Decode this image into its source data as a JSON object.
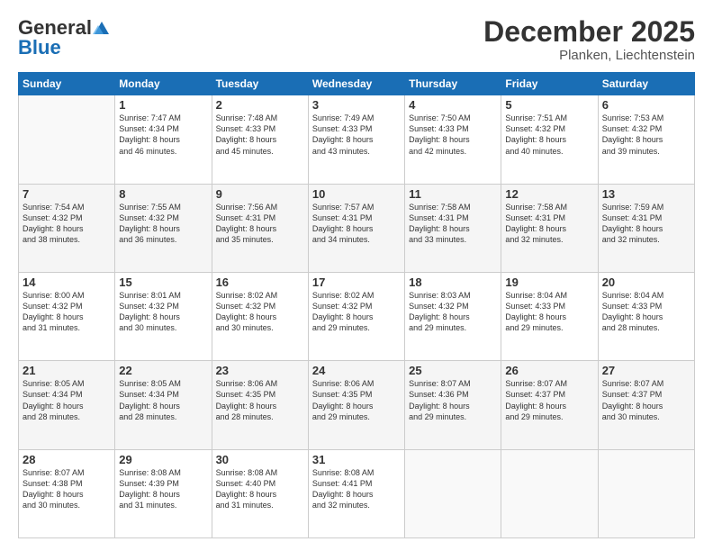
{
  "header": {
    "logo_general": "General",
    "logo_blue": "Blue",
    "month": "December 2025",
    "location": "Planken, Liechtenstein"
  },
  "days_of_week": [
    "Sunday",
    "Monday",
    "Tuesday",
    "Wednesday",
    "Thursday",
    "Friday",
    "Saturday"
  ],
  "weeks": [
    [
      {
        "day": "",
        "info": ""
      },
      {
        "day": "1",
        "info": "Sunrise: 7:47 AM\nSunset: 4:34 PM\nDaylight: 8 hours\nand 46 minutes."
      },
      {
        "day": "2",
        "info": "Sunrise: 7:48 AM\nSunset: 4:33 PM\nDaylight: 8 hours\nand 45 minutes."
      },
      {
        "day": "3",
        "info": "Sunrise: 7:49 AM\nSunset: 4:33 PM\nDaylight: 8 hours\nand 43 minutes."
      },
      {
        "day": "4",
        "info": "Sunrise: 7:50 AM\nSunset: 4:33 PM\nDaylight: 8 hours\nand 42 minutes."
      },
      {
        "day": "5",
        "info": "Sunrise: 7:51 AM\nSunset: 4:32 PM\nDaylight: 8 hours\nand 40 minutes."
      },
      {
        "day": "6",
        "info": "Sunrise: 7:53 AM\nSunset: 4:32 PM\nDaylight: 8 hours\nand 39 minutes."
      }
    ],
    [
      {
        "day": "7",
        "info": "Sunrise: 7:54 AM\nSunset: 4:32 PM\nDaylight: 8 hours\nand 38 minutes."
      },
      {
        "day": "8",
        "info": "Sunrise: 7:55 AM\nSunset: 4:32 PM\nDaylight: 8 hours\nand 36 minutes."
      },
      {
        "day": "9",
        "info": "Sunrise: 7:56 AM\nSunset: 4:31 PM\nDaylight: 8 hours\nand 35 minutes."
      },
      {
        "day": "10",
        "info": "Sunrise: 7:57 AM\nSunset: 4:31 PM\nDaylight: 8 hours\nand 34 minutes."
      },
      {
        "day": "11",
        "info": "Sunrise: 7:58 AM\nSunset: 4:31 PM\nDaylight: 8 hours\nand 33 minutes."
      },
      {
        "day": "12",
        "info": "Sunrise: 7:58 AM\nSunset: 4:31 PM\nDaylight: 8 hours\nand 32 minutes."
      },
      {
        "day": "13",
        "info": "Sunrise: 7:59 AM\nSunset: 4:31 PM\nDaylight: 8 hours\nand 32 minutes."
      }
    ],
    [
      {
        "day": "14",
        "info": "Sunrise: 8:00 AM\nSunset: 4:32 PM\nDaylight: 8 hours\nand 31 minutes."
      },
      {
        "day": "15",
        "info": "Sunrise: 8:01 AM\nSunset: 4:32 PM\nDaylight: 8 hours\nand 30 minutes."
      },
      {
        "day": "16",
        "info": "Sunrise: 8:02 AM\nSunset: 4:32 PM\nDaylight: 8 hours\nand 30 minutes."
      },
      {
        "day": "17",
        "info": "Sunrise: 8:02 AM\nSunset: 4:32 PM\nDaylight: 8 hours\nand 29 minutes."
      },
      {
        "day": "18",
        "info": "Sunrise: 8:03 AM\nSunset: 4:32 PM\nDaylight: 8 hours\nand 29 minutes."
      },
      {
        "day": "19",
        "info": "Sunrise: 8:04 AM\nSunset: 4:33 PM\nDaylight: 8 hours\nand 29 minutes."
      },
      {
        "day": "20",
        "info": "Sunrise: 8:04 AM\nSunset: 4:33 PM\nDaylight: 8 hours\nand 28 minutes."
      }
    ],
    [
      {
        "day": "21",
        "info": "Sunrise: 8:05 AM\nSunset: 4:34 PM\nDaylight: 8 hours\nand 28 minutes."
      },
      {
        "day": "22",
        "info": "Sunrise: 8:05 AM\nSunset: 4:34 PM\nDaylight: 8 hours\nand 28 minutes."
      },
      {
        "day": "23",
        "info": "Sunrise: 8:06 AM\nSunset: 4:35 PM\nDaylight: 8 hours\nand 28 minutes."
      },
      {
        "day": "24",
        "info": "Sunrise: 8:06 AM\nSunset: 4:35 PM\nDaylight: 8 hours\nand 29 minutes."
      },
      {
        "day": "25",
        "info": "Sunrise: 8:07 AM\nSunset: 4:36 PM\nDaylight: 8 hours\nand 29 minutes."
      },
      {
        "day": "26",
        "info": "Sunrise: 8:07 AM\nSunset: 4:37 PM\nDaylight: 8 hours\nand 29 minutes."
      },
      {
        "day": "27",
        "info": "Sunrise: 8:07 AM\nSunset: 4:37 PM\nDaylight: 8 hours\nand 30 minutes."
      }
    ],
    [
      {
        "day": "28",
        "info": "Sunrise: 8:07 AM\nSunset: 4:38 PM\nDaylight: 8 hours\nand 30 minutes."
      },
      {
        "day": "29",
        "info": "Sunrise: 8:08 AM\nSunset: 4:39 PM\nDaylight: 8 hours\nand 31 minutes."
      },
      {
        "day": "30",
        "info": "Sunrise: 8:08 AM\nSunset: 4:40 PM\nDaylight: 8 hours\nand 31 minutes."
      },
      {
        "day": "31",
        "info": "Sunrise: 8:08 AM\nSunset: 4:41 PM\nDaylight: 8 hours\nand 32 minutes."
      },
      {
        "day": "",
        "info": ""
      },
      {
        "day": "",
        "info": ""
      },
      {
        "day": "",
        "info": ""
      }
    ]
  ]
}
